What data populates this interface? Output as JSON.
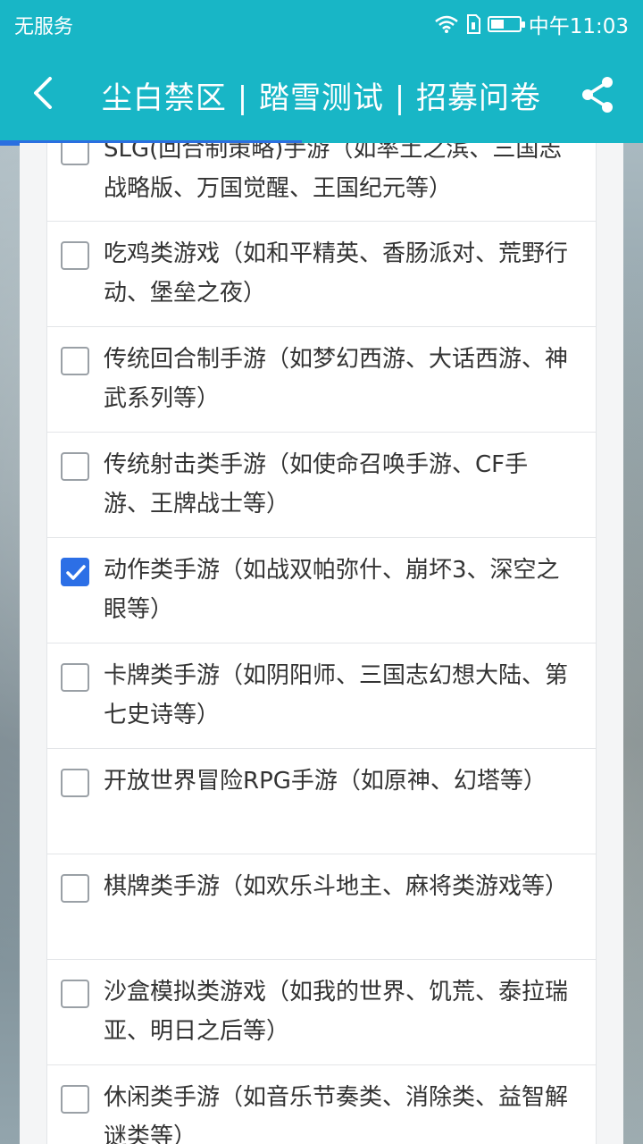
{
  "status_bar": {
    "carrier": "无服务",
    "time": "中午11:03"
  },
  "nav": {
    "title": "尘白禁区 | 踏雪测试 | 招募问卷",
    "back_icon": "back-arrow-icon",
    "share_icon": "share-icon"
  },
  "progress": 0.47,
  "options": [
    {
      "label": "SLG(回合制策略)手游（如率土之滨、三国志战略版、万国觉醒、王国纪元等）",
      "checked": false
    },
    {
      "label": "吃鸡类游戏（如和平精英、香肠派对、荒野行动、堡垒之夜）",
      "checked": false
    },
    {
      "label": "传统回合制手游（如梦幻西游、大话西游、神武系列等）",
      "checked": false
    },
    {
      "label": "传统射击类手游（如使命召唤手游、CF手游、王牌战士等）",
      "checked": false
    },
    {
      "label": "动作类手游（如战双帕弥什、崩坏3、深空之眼等）",
      "checked": true
    },
    {
      "label": "卡牌类手游（如阴阳师、三国志幻想大陆、第七史诗等）",
      "checked": false
    },
    {
      "label": "开放世界冒险RPG手游（如原神、幻塔等）",
      "checked": false
    },
    {
      "label": "棋牌类手游（如欢乐斗地主、麻将类游戏等）",
      "checked": false
    },
    {
      "label": "沙盒模拟类游戏（如我的世界、饥荒、泰拉瑞亚、明日之后等）",
      "checked": false
    },
    {
      "label": "休闲类手游（如音乐节奏类、消除类、益智解谜类等）",
      "checked": false
    }
  ]
}
